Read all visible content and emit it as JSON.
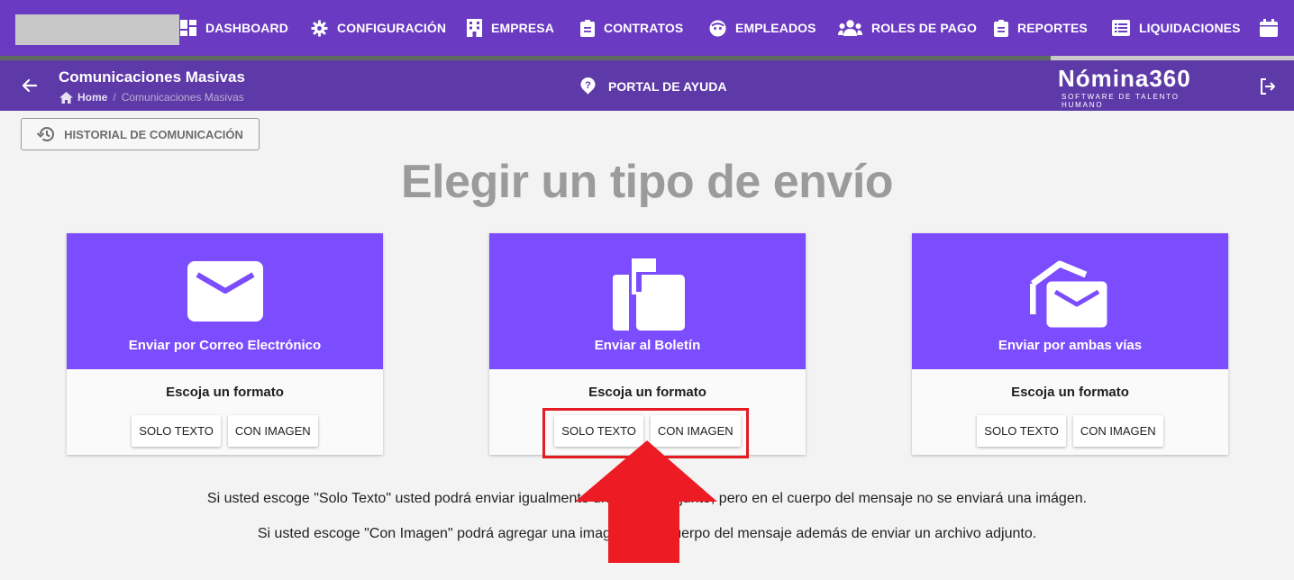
{
  "nav": {
    "items": [
      {
        "label": "DASHBOARD",
        "icon": "dashboard-icon"
      },
      {
        "label": "CONFIGURACIÓN",
        "icon": "gear-icon"
      },
      {
        "label": "EMPRESA",
        "icon": "building-icon"
      },
      {
        "label": "CONTRATOS",
        "icon": "clipboard-icon"
      },
      {
        "label": "EMPLEADOS",
        "icon": "face-icon"
      },
      {
        "label": "ROLES DE PAGO",
        "icon": "people-icon"
      },
      {
        "label": "REPORTES",
        "icon": "clipboard-icon"
      },
      {
        "label": "LIQUIDACIONES",
        "icon": "list-icon"
      },
      {
        "label": "",
        "icon": "calendar-icon"
      }
    ]
  },
  "header": {
    "title": "Comunicaciones Masivas",
    "breadcrumb": {
      "home": "Home",
      "separator": "/",
      "current": "Comunicaciones Masivas"
    },
    "help_label": "PORTAL DE AYUDA",
    "brand_name": "Nómina360",
    "brand_tagline": "SOFTWARE DE TALENTO HUMANO"
  },
  "history_button": "HISTORIAL DE COMUNICACIÓN",
  "main_title": "Elegir un tipo de envío",
  "cards": [
    {
      "title": "Enviar por Correo Electrónico",
      "icon": "mail-icon",
      "subtitle": "Escoja un formato",
      "btn_text": "SOLO TEXTO",
      "btn_image": "CON IMAGEN"
    },
    {
      "title": "Enviar al Boletín",
      "icon": "mailbox-icon",
      "subtitle": "Escoja un formato",
      "btn_text": "SOLO TEXTO",
      "btn_image": "CON IMAGEN"
    },
    {
      "title": "Enviar por ambas vías",
      "icon": "mail-stack-icon",
      "subtitle": "Escoja un formato",
      "btn_text": "SOLO TEXTO",
      "btn_image": "CON IMAGEN"
    }
  ],
  "info": {
    "line1": "Si usted escoge \"Solo Texto\" usted podrá enviar igualmente un archivo adjunto, pero en el cuerpo del mensaje no se enviará una imágen.",
    "line2": "Si usted escoge \"Con Imagen\" podrá agregar una imagen en el cuerpo del mensaje además de enviar un archivo adjunto."
  },
  "colors": {
    "nav_bg": "#6a3bc2",
    "subheader_bg": "#5e3aa8",
    "card_accent": "#7c4dff",
    "annotation": "#e31b23",
    "title_grey": "#9b9b9b"
  }
}
